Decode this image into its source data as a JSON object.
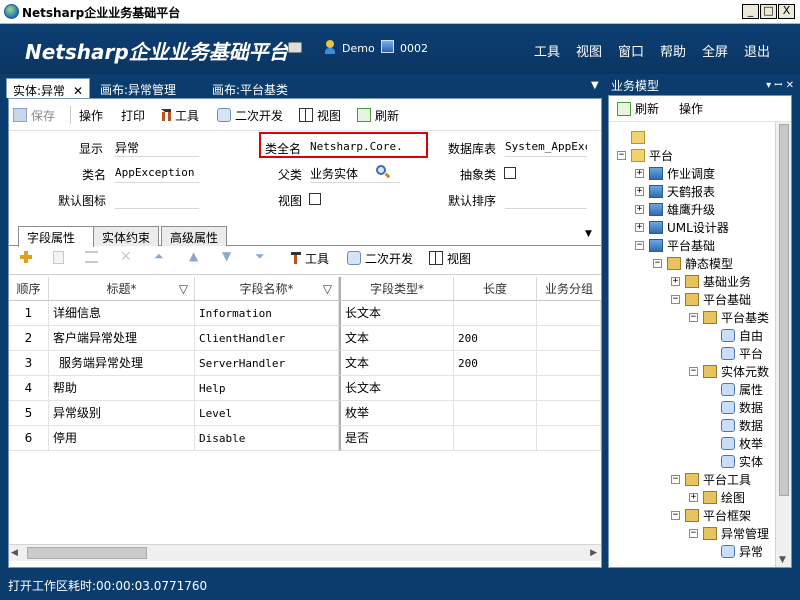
{
  "window": {
    "title": "Netsharp企业业务基础平台",
    "min": "_",
    "max": "□",
    "close": "X"
  },
  "header": {
    "brand": "Netsharp企业业务基础平台",
    "user": "Demo",
    "code": "0002",
    "menus": [
      "工具",
      "视图",
      "窗口",
      "帮助",
      "全屏",
      "退出"
    ]
  },
  "doc_tabs": [
    {
      "label": "实体:异常",
      "close": "✕"
    },
    {
      "label": "画布:异常管理"
    },
    {
      "label": "画布:平台基类"
    }
  ],
  "doc_tabs_dropdown": "▼",
  "toolbar": {
    "save": "保存",
    "action": "操作",
    "print": "打印",
    "tools": "工具",
    "secondary_dev": "二次开发",
    "view": "视图",
    "refresh": "刷新"
  },
  "form": {
    "display_label": "显示",
    "display_value": "异常",
    "fullname_label": "类全名",
    "fullname_value": "Netsharp.Core.",
    "db_label": "数据库表",
    "db_value": "System_AppExce",
    "classname_label": "类名",
    "classname_value": "AppException",
    "parent_label": "父类",
    "parent_value": "业务实体",
    "abstract_label": "抽象类",
    "default_icon_label": "默认图标",
    "view_label": "视图",
    "default_sort_label": "默认排序"
  },
  "sub_tabs": [
    "字段属性",
    "实体约束",
    "高级属性"
  ],
  "sub_toolbar": {
    "tools": "工具",
    "secondary_dev": "二次开发",
    "view": "视图"
  },
  "grid": {
    "columns": [
      "顺序",
      "标题*",
      "字段名称*",
      "字段类型*",
      "长度",
      "业务分组"
    ],
    "rows": [
      {
        "seq": "1",
        "title": "详细信息",
        "field": "Information",
        "type": "长文本",
        "length": ""
      },
      {
        "seq": "2",
        "title": "客户端异常处理",
        "field": "ClientHandler",
        "type": "文本",
        "length": "200"
      },
      {
        "seq": "3",
        "title": "服务端异常处理",
        "field": "ServerHandler",
        "type": "文本",
        "length": "200"
      },
      {
        "seq": "4",
        "title": "帮助",
        "field": "Help",
        "type": "长文本",
        "length": ""
      },
      {
        "seq": "5",
        "title": "异常级别",
        "field": "Level",
        "type": "枚举",
        "length": ""
      },
      {
        "seq": "6",
        "title": "停用",
        "field": "Disable",
        "type": "是否",
        "length": ""
      }
    ]
  },
  "right_panel": {
    "title": "业务模型",
    "controls": "▾ ꟷ ✕",
    "refresh": "刷新",
    "action": "操作",
    "tree": [
      {
        "label": "",
        "icon": "folder",
        "level": 0,
        "pm": ""
      },
      {
        "label": "平台",
        "icon": "folder",
        "level": 0,
        "pm": "−"
      },
      {
        "label": "作业调度",
        "icon": "mod",
        "level": 1,
        "pm": "+"
      },
      {
        "label": "天鹤报表",
        "icon": "mod",
        "level": 1,
        "pm": "+"
      },
      {
        "label": "雄鹰升级",
        "icon": "mod",
        "level": 1,
        "pm": "+"
      },
      {
        "label": "UML设计器",
        "icon": "mod",
        "level": 1,
        "pm": "+"
      },
      {
        "label": "平台基础",
        "icon": "mod",
        "level": 1,
        "pm": "−"
      },
      {
        "label": "静态模型",
        "icon": "box",
        "level": 2,
        "pm": "−"
      },
      {
        "label": "基础业务",
        "icon": "box",
        "level": 3,
        "pm": "+"
      },
      {
        "label": "平台基础",
        "icon": "box",
        "level": 3,
        "pm": "−"
      },
      {
        "label": "平台基类",
        "icon": "box",
        "level": 4,
        "pm": "−"
      },
      {
        "label": "自由",
        "icon": "ent",
        "level": 5,
        "pm": ""
      },
      {
        "label": "平台",
        "icon": "ent",
        "level": 5,
        "pm": ""
      },
      {
        "label": "实体元数",
        "icon": "box",
        "level": 4,
        "pm": "−"
      },
      {
        "label": "属性",
        "icon": "ent",
        "level": 5,
        "pm": ""
      },
      {
        "label": "数据",
        "icon": "ent",
        "level": 5,
        "pm": ""
      },
      {
        "label": "数据",
        "icon": "ent",
        "level": 5,
        "pm": ""
      },
      {
        "label": "枚举",
        "icon": "ent",
        "level": 5,
        "pm": ""
      },
      {
        "label": "实体",
        "icon": "ent",
        "level": 5,
        "pm": ""
      },
      {
        "label": "平台工具",
        "icon": "box",
        "level": 3,
        "pm": "−"
      },
      {
        "label": "绘图",
        "icon": "box",
        "level": 4,
        "pm": "+"
      },
      {
        "label": "平台框架",
        "icon": "box",
        "level": 3,
        "pm": "−"
      },
      {
        "label": "异常管理",
        "icon": "box",
        "level": 4,
        "pm": "−"
      },
      {
        "label": "异常",
        "icon": "ent",
        "level": 5,
        "pm": ""
      }
    ]
  },
  "status": "打开工作区耗时:00:00:03.0771760",
  "colors": {
    "brand_bg": "#0b3c6e",
    "highlight_border": "#e00000"
  }
}
